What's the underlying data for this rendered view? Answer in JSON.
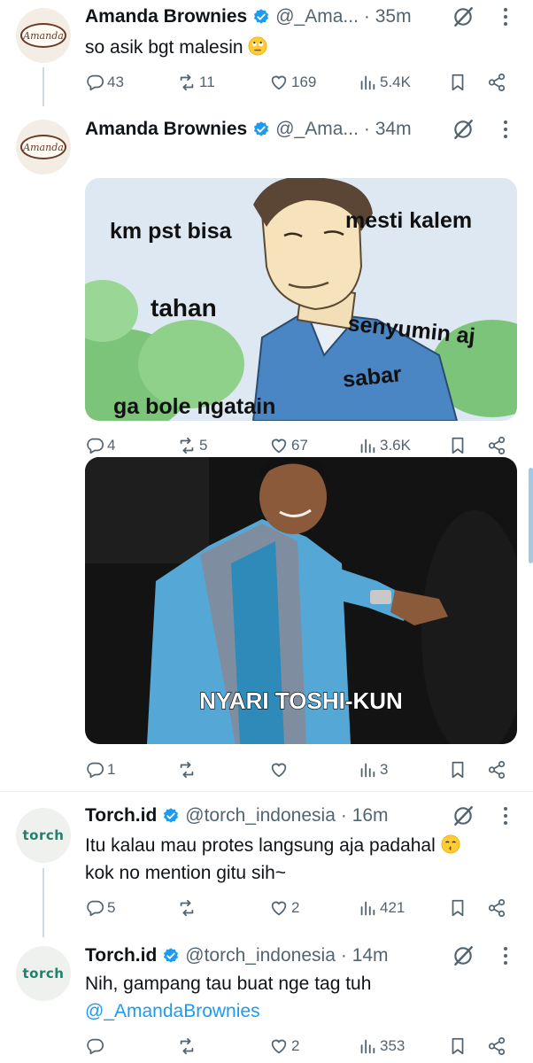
{
  "posts": [
    {
      "author": "Amanda Brownies",
      "handle": "@_Ama...",
      "time": "· 35m",
      "text": "so asik bgt malesin",
      "emoji": "rolling-eyes-emoji",
      "stats": {
        "replies": "43",
        "reposts": "11",
        "likes": "169",
        "views": "5.4K"
      }
    },
    {
      "author": "Amanda Brownies",
      "handle": "@_Ama...",
      "time": "· 34m",
      "images": [
        {
          "captions": [
            "km pst bisa",
            "mesti kalem",
            "tahan",
            "senyumin aj",
            "sabar",
            "ga bole ngatain"
          ]
        }
      ],
      "stats": {
        "replies": "4",
        "reposts": "5",
        "likes": "67",
        "views": "3.6K"
      }
    },
    {
      "images": [
        {
          "caption": "NYARI TOSHI-KUN"
        }
      ],
      "stats": {
        "replies": "1",
        "reposts": "",
        "likes": "",
        "views": "3"
      }
    },
    {
      "author": "Torch.id",
      "handle": "@torch_indonesia",
      "time": "· 16m",
      "text_line1": "Itu kalau mau protes langsung aja padahal",
      "text_line2": "kok no mention gitu sih~",
      "emoji": "kissing-emoji",
      "stats": {
        "replies": "5",
        "reposts": "",
        "likes": "2",
        "views": "421"
      }
    },
    {
      "author": "Torch.id",
      "handle": "@torch_indonesia",
      "time": "· 14m",
      "text": "Nih, gampang tau buat nge tag tuh",
      "mention": "@_AmandaBrownies",
      "stats": {
        "replies": "",
        "reposts": "",
        "likes": "2",
        "views": "353"
      }
    }
  ],
  "avatars": {
    "amanda_logo": "Amanda",
    "torch_logo": "torch"
  },
  "colors": {
    "accent": "#1d9bf0",
    "muted": "#536471",
    "thread": "#cfd9de"
  }
}
